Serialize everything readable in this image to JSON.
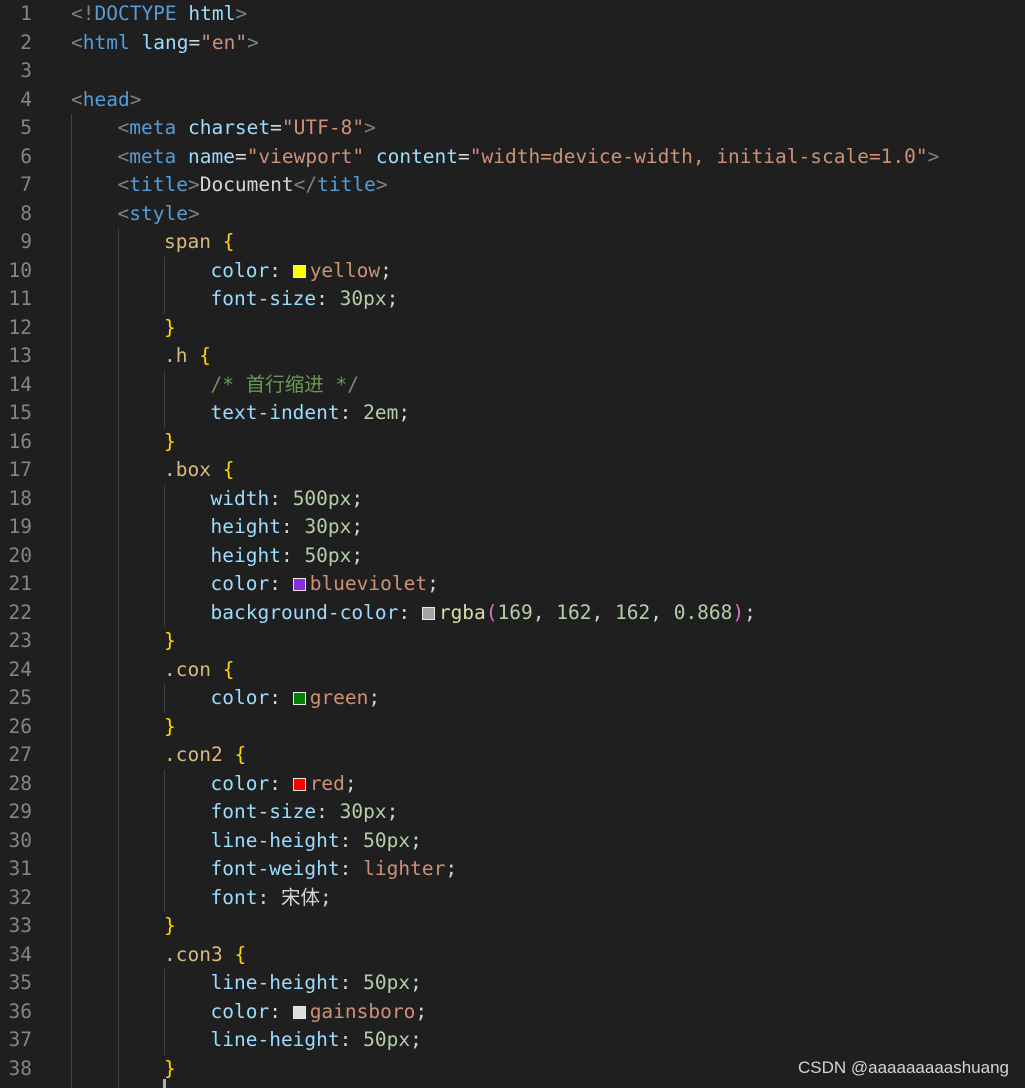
{
  "colors": {
    "background": "#1f1f1f",
    "line_number": "#858585",
    "punctuation_tag": "#808080",
    "tag": "#569cd6",
    "attribute": "#9cdcfe",
    "string": "#ce9178",
    "text": "#d4d4d4",
    "selector": "#d7ba7d",
    "brace": "#ffd700",
    "property": "#9cdcfe",
    "number": "#b5cea8",
    "comment": "#6a9955",
    "function": "#dcdcaa",
    "paren": "#da70d6"
  },
  "lines": [
    {
      "n": "1",
      "indent": 0,
      "tokens": [
        {
          "t": "<!",
          "c": "punctuation_tag"
        },
        {
          "t": "DOCTYPE",
          "c": "tag"
        },
        {
          "t": " ",
          "c": "text"
        },
        {
          "t": "html",
          "c": "attribute"
        },
        {
          "t": ">",
          "c": "punctuation_tag"
        }
      ]
    },
    {
      "n": "2",
      "indent": 0,
      "tokens": [
        {
          "t": "<",
          "c": "punctuation_tag"
        },
        {
          "t": "html",
          "c": "tag"
        },
        {
          "t": " ",
          "c": "text"
        },
        {
          "t": "lang",
          "c": "attribute"
        },
        {
          "t": "=",
          "c": "text"
        },
        {
          "t": "\"en\"",
          "c": "string"
        },
        {
          "t": ">",
          "c": "punctuation_tag"
        }
      ]
    },
    {
      "n": "3",
      "indent": 0,
      "tokens": []
    },
    {
      "n": "4",
      "indent": 0,
      "tokens": [
        {
          "t": "<",
          "c": "punctuation_tag"
        },
        {
          "t": "head",
          "c": "tag"
        },
        {
          "t": ">",
          "c": "punctuation_tag"
        }
      ]
    },
    {
      "n": "5",
      "indent": 1,
      "tokens": [
        {
          "t": "<",
          "c": "punctuation_tag"
        },
        {
          "t": "meta",
          "c": "tag"
        },
        {
          "t": " ",
          "c": "text"
        },
        {
          "t": "charset",
          "c": "attribute"
        },
        {
          "t": "=",
          "c": "text"
        },
        {
          "t": "\"UTF-8\"",
          "c": "string"
        },
        {
          "t": ">",
          "c": "punctuation_tag"
        }
      ]
    },
    {
      "n": "6",
      "indent": 1,
      "tokens": [
        {
          "t": "<",
          "c": "punctuation_tag"
        },
        {
          "t": "meta",
          "c": "tag"
        },
        {
          "t": " ",
          "c": "text"
        },
        {
          "t": "name",
          "c": "attribute"
        },
        {
          "t": "=",
          "c": "text"
        },
        {
          "t": "\"viewport\"",
          "c": "string"
        },
        {
          "t": " ",
          "c": "text"
        },
        {
          "t": "content",
          "c": "attribute"
        },
        {
          "t": "=",
          "c": "text"
        },
        {
          "t": "\"width=device-width, initial-scale=1.0\"",
          "c": "string"
        },
        {
          "t": ">",
          "c": "punctuation_tag"
        }
      ]
    },
    {
      "n": "7",
      "indent": 1,
      "tokens": [
        {
          "t": "<",
          "c": "punctuation_tag"
        },
        {
          "t": "title",
          "c": "tag"
        },
        {
          "t": ">",
          "c": "punctuation_tag"
        },
        {
          "t": "Document",
          "c": "text"
        },
        {
          "t": "</",
          "c": "punctuation_tag"
        },
        {
          "t": "title",
          "c": "tag"
        },
        {
          "t": ">",
          "c": "punctuation_tag"
        }
      ]
    },
    {
      "n": "8",
      "indent": 1,
      "tokens": [
        {
          "t": "<",
          "c": "punctuation_tag"
        },
        {
          "t": "style",
          "c": "tag"
        },
        {
          "t": ">",
          "c": "punctuation_tag"
        }
      ]
    },
    {
      "n": "9",
      "indent": 2,
      "tokens": [
        {
          "t": "span",
          "c": "selector"
        },
        {
          "t": " ",
          "c": "text"
        },
        {
          "t": "{",
          "c": "brace"
        }
      ]
    },
    {
      "n": "10",
      "indent": 3,
      "tokens": [
        {
          "t": "color",
          "c": "property"
        },
        {
          "t": ": ",
          "c": "text"
        },
        {
          "swatch": "#ffff00"
        },
        {
          "t": "yellow",
          "c": "string"
        },
        {
          "t": ";",
          "c": "text"
        }
      ]
    },
    {
      "n": "11",
      "indent": 3,
      "tokens": [
        {
          "t": "font-size",
          "c": "property"
        },
        {
          "t": ": ",
          "c": "text"
        },
        {
          "t": "30px",
          "c": "number"
        },
        {
          "t": ";",
          "c": "text"
        }
      ]
    },
    {
      "n": "12",
      "indent": 2,
      "tokens": [
        {
          "t": "}",
          "c": "brace"
        }
      ]
    },
    {
      "n": "13",
      "indent": 2,
      "tokens": [
        {
          "t": ".h",
          "c": "selector"
        },
        {
          "t": " ",
          "c": "text"
        },
        {
          "t": "{",
          "c": "brace"
        }
      ]
    },
    {
      "n": "14",
      "indent": 3,
      "tokens": [
        {
          "t": "/* 首行缩进 */",
          "c": "comment"
        }
      ]
    },
    {
      "n": "15",
      "indent": 3,
      "tokens": [
        {
          "t": "text-indent",
          "c": "property"
        },
        {
          "t": ": ",
          "c": "text"
        },
        {
          "t": "2em",
          "c": "number"
        },
        {
          "t": ";",
          "c": "text"
        }
      ]
    },
    {
      "n": "16",
      "indent": 2,
      "tokens": [
        {
          "t": "}",
          "c": "brace"
        }
      ]
    },
    {
      "n": "17",
      "indent": 2,
      "tokens": [
        {
          "t": ".box",
          "c": "selector"
        },
        {
          "t": " ",
          "c": "text"
        },
        {
          "t": "{",
          "c": "brace"
        }
      ]
    },
    {
      "n": "18",
      "indent": 3,
      "tokens": [
        {
          "t": "width",
          "c": "property"
        },
        {
          "t": ": ",
          "c": "text"
        },
        {
          "t": "500px",
          "c": "number"
        },
        {
          "t": ";",
          "c": "text"
        }
      ]
    },
    {
      "n": "19",
      "indent": 3,
      "tokens": [
        {
          "t": "height",
          "c": "property"
        },
        {
          "t": ": ",
          "c": "text"
        },
        {
          "t": "30px",
          "c": "number"
        },
        {
          "t": ";",
          "c": "text"
        }
      ]
    },
    {
      "n": "20",
      "indent": 3,
      "tokens": [
        {
          "t": "height",
          "c": "property"
        },
        {
          "t": ": ",
          "c": "text"
        },
        {
          "t": "50px",
          "c": "number"
        },
        {
          "t": ";",
          "c": "text"
        }
      ]
    },
    {
      "n": "21",
      "indent": 3,
      "tokens": [
        {
          "t": "color",
          "c": "property"
        },
        {
          "t": ": ",
          "c": "text"
        },
        {
          "swatch": "#8a2be2"
        },
        {
          "t": "blueviolet",
          "c": "string"
        },
        {
          "t": ";",
          "c": "text"
        }
      ]
    },
    {
      "n": "22",
      "indent": 3,
      "tokens": [
        {
          "t": "background-color",
          "c": "property"
        },
        {
          "t": ": ",
          "c": "text"
        },
        {
          "swatch": "#a9a2a2"
        },
        {
          "t": "rgba",
          "c": "function"
        },
        {
          "t": "(",
          "c": "paren"
        },
        {
          "t": "169",
          "c": "number"
        },
        {
          "t": ", ",
          "c": "text"
        },
        {
          "t": "162",
          "c": "number"
        },
        {
          "t": ", ",
          "c": "text"
        },
        {
          "t": "162",
          "c": "number"
        },
        {
          "t": ", ",
          "c": "text"
        },
        {
          "t": "0.868",
          "c": "number"
        },
        {
          "t": ")",
          "c": "paren"
        },
        {
          "t": ";",
          "c": "text"
        }
      ]
    },
    {
      "n": "23",
      "indent": 2,
      "tokens": [
        {
          "t": "}",
          "c": "brace"
        }
      ]
    },
    {
      "n": "24",
      "indent": 2,
      "tokens": [
        {
          "t": ".con",
          "c": "selector"
        },
        {
          "t": " ",
          "c": "text"
        },
        {
          "t": "{",
          "c": "brace"
        }
      ]
    },
    {
      "n": "25",
      "indent": 3,
      "tokens": [
        {
          "t": "color",
          "c": "property"
        },
        {
          "t": ": ",
          "c": "text"
        },
        {
          "swatch": "#008000"
        },
        {
          "t": "green",
          "c": "string"
        },
        {
          "t": ";",
          "c": "text"
        }
      ]
    },
    {
      "n": "26",
      "indent": 2,
      "tokens": [
        {
          "t": "}",
          "c": "brace"
        }
      ]
    },
    {
      "n": "27",
      "indent": 2,
      "tokens": [
        {
          "t": ".con2",
          "c": "selector"
        },
        {
          "t": " ",
          "c": "text"
        },
        {
          "t": "{",
          "c": "brace"
        }
      ]
    },
    {
      "n": "28",
      "indent": 3,
      "tokens": [
        {
          "t": "color",
          "c": "property"
        },
        {
          "t": ": ",
          "c": "text"
        },
        {
          "swatch": "#ff0000"
        },
        {
          "t": "red",
          "c": "string"
        },
        {
          "t": ";",
          "c": "text"
        }
      ]
    },
    {
      "n": "29",
      "indent": 3,
      "tokens": [
        {
          "t": "font-size",
          "c": "property"
        },
        {
          "t": ": ",
          "c": "text"
        },
        {
          "t": "30px",
          "c": "number"
        },
        {
          "t": ";",
          "c": "text"
        }
      ]
    },
    {
      "n": "30",
      "indent": 3,
      "tokens": [
        {
          "t": "line-height",
          "c": "property"
        },
        {
          "t": ": ",
          "c": "text"
        },
        {
          "t": "50px",
          "c": "number"
        },
        {
          "t": ";",
          "c": "text"
        }
      ]
    },
    {
      "n": "31",
      "indent": 3,
      "tokens": [
        {
          "t": "font-weight",
          "c": "property"
        },
        {
          "t": ": ",
          "c": "text"
        },
        {
          "t": "lighter",
          "c": "string"
        },
        {
          "t": ";",
          "c": "text"
        }
      ]
    },
    {
      "n": "32",
      "indent": 3,
      "tokens": [
        {
          "t": "font",
          "c": "property"
        },
        {
          "t": ": ",
          "c": "text"
        },
        {
          "t": "宋体",
          "c": "text"
        },
        {
          "t": ";",
          "c": "text"
        }
      ]
    },
    {
      "n": "33",
      "indent": 2,
      "tokens": [
        {
          "t": "}",
          "c": "brace"
        }
      ]
    },
    {
      "n": "34",
      "indent": 2,
      "tokens": [
        {
          "t": ".con3",
          "c": "selector"
        },
        {
          "t": " ",
          "c": "text"
        },
        {
          "t": "{",
          "c": "brace"
        }
      ]
    },
    {
      "n": "35",
      "indent": 3,
      "tokens": [
        {
          "t": "line-height",
          "c": "property"
        },
        {
          "t": ": ",
          "c": "text"
        },
        {
          "t": "50px",
          "c": "number"
        },
        {
          "t": ";",
          "c": "text"
        }
      ]
    },
    {
      "n": "36",
      "indent": 3,
      "tokens": [
        {
          "t": "color",
          "c": "property"
        },
        {
          "t": ": ",
          "c": "text"
        },
        {
          "swatch": "#dcdcdc"
        },
        {
          "t": "gainsboro",
          "c": "string"
        },
        {
          "t": ";",
          "c": "text"
        }
      ]
    },
    {
      "n": "37",
      "indent": 3,
      "tokens": [
        {
          "t": "line-height",
          "c": "property"
        },
        {
          "t": ": ",
          "c": "text"
        },
        {
          "t": "50px",
          "c": "number"
        },
        {
          "t": ";",
          "c": "text"
        }
      ]
    },
    {
      "n": "38",
      "indent": 2,
      "tokens": [
        {
          "t": "}",
          "c": "brace"
        }
      ]
    }
  ],
  "watermark": "CSDN @aaaaaaaaashuang"
}
